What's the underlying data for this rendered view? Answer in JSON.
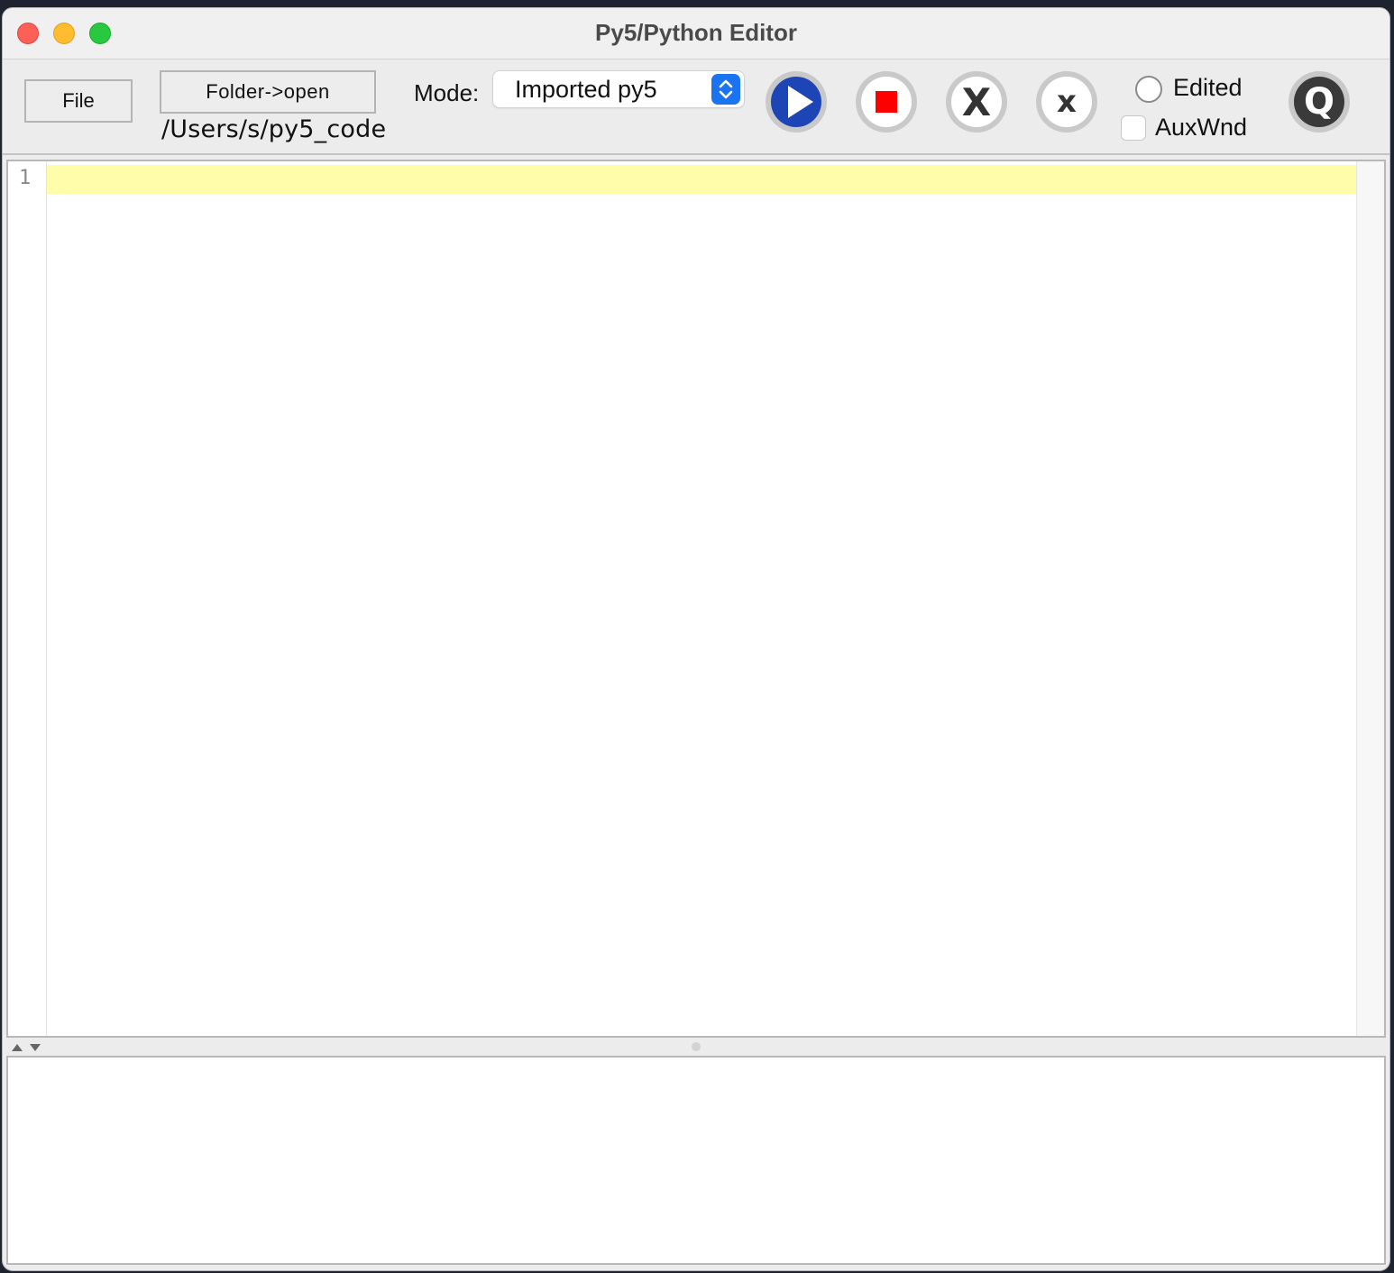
{
  "window": {
    "title": "Py5/Python Editor"
  },
  "toolbar": {
    "file_label": "File",
    "folder_label": "Folder->open",
    "folder_path": "/Users/s/py5_code",
    "mode_label": "Mode:",
    "mode_value": "Imported py5",
    "run_icon": "play-icon",
    "stop_icon": "stop-icon",
    "clear_big_glyph": "X",
    "clear_small_glyph": "x",
    "quit_glyph": "Q",
    "edited_label": "Edited",
    "edited_checked": false,
    "auxwnd_label": "AuxWnd",
    "auxwnd_checked": false
  },
  "editor": {
    "line_numbers": [
      "1"
    ],
    "current_line_color": "#fffcaa"
  },
  "console": {
    "text": ""
  },
  "colors": {
    "run_button": "#1d45b5",
    "stop_square": "#ff0000",
    "mode_stepper": "#1a73f0"
  }
}
